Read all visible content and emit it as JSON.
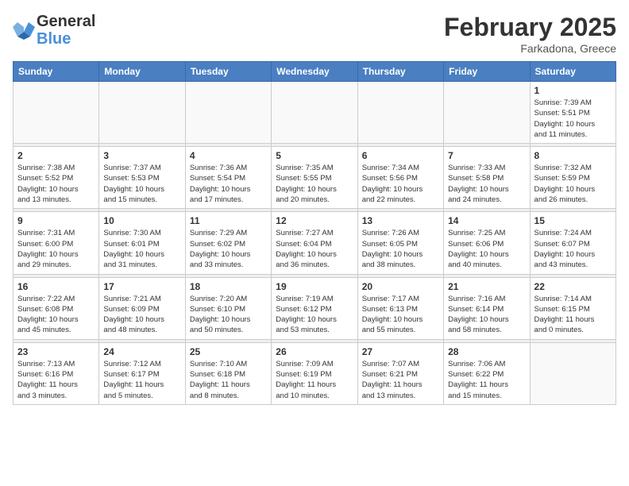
{
  "header": {
    "logo_general": "General",
    "logo_blue": "Blue",
    "month_title": "February 2025",
    "location": "Farkadona, Greece"
  },
  "weekdays": [
    "Sunday",
    "Monday",
    "Tuesday",
    "Wednesday",
    "Thursday",
    "Friday",
    "Saturday"
  ],
  "weeks": [
    [
      {
        "day": "",
        "info": ""
      },
      {
        "day": "",
        "info": ""
      },
      {
        "day": "",
        "info": ""
      },
      {
        "day": "",
        "info": ""
      },
      {
        "day": "",
        "info": ""
      },
      {
        "day": "",
        "info": ""
      },
      {
        "day": "1",
        "info": "Sunrise: 7:39 AM\nSunset: 5:51 PM\nDaylight: 10 hours\nand 11 minutes."
      }
    ],
    [
      {
        "day": "2",
        "info": "Sunrise: 7:38 AM\nSunset: 5:52 PM\nDaylight: 10 hours\nand 13 minutes."
      },
      {
        "day": "3",
        "info": "Sunrise: 7:37 AM\nSunset: 5:53 PM\nDaylight: 10 hours\nand 15 minutes."
      },
      {
        "day": "4",
        "info": "Sunrise: 7:36 AM\nSunset: 5:54 PM\nDaylight: 10 hours\nand 17 minutes."
      },
      {
        "day": "5",
        "info": "Sunrise: 7:35 AM\nSunset: 5:55 PM\nDaylight: 10 hours\nand 20 minutes."
      },
      {
        "day": "6",
        "info": "Sunrise: 7:34 AM\nSunset: 5:56 PM\nDaylight: 10 hours\nand 22 minutes."
      },
      {
        "day": "7",
        "info": "Sunrise: 7:33 AM\nSunset: 5:58 PM\nDaylight: 10 hours\nand 24 minutes."
      },
      {
        "day": "8",
        "info": "Sunrise: 7:32 AM\nSunset: 5:59 PM\nDaylight: 10 hours\nand 26 minutes."
      }
    ],
    [
      {
        "day": "9",
        "info": "Sunrise: 7:31 AM\nSunset: 6:00 PM\nDaylight: 10 hours\nand 29 minutes."
      },
      {
        "day": "10",
        "info": "Sunrise: 7:30 AM\nSunset: 6:01 PM\nDaylight: 10 hours\nand 31 minutes."
      },
      {
        "day": "11",
        "info": "Sunrise: 7:29 AM\nSunset: 6:02 PM\nDaylight: 10 hours\nand 33 minutes."
      },
      {
        "day": "12",
        "info": "Sunrise: 7:27 AM\nSunset: 6:04 PM\nDaylight: 10 hours\nand 36 minutes."
      },
      {
        "day": "13",
        "info": "Sunrise: 7:26 AM\nSunset: 6:05 PM\nDaylight: 10 hours\nand 38 minutes."
      },
      {
        "day": "14",
        "info": "Sunrise: 7:25 AM\nSunset: 6:06 PM\nDaylight: 10 hours\nand 40 minutes."
      },
      {
        "day": "15",
        "info": "Sunrise: 7:24 AM\nSunset: 6:07 PM\nDaylight: 10 hours\nand 43 minutes."
      }
    ],
    [
      {
        "day": "16",
        "info": "Sunrise: 7:22 AM\nSunset: 6:08 PM\nDaylight: 10 hours\nand 45 minutes."
      },
      {
        "day": "17",
        "info": "Sunrise: 7:21 AM\nSunset: 6:09 PM\nDaylight: 10 hours\nand 48 minutes."
      },
      {
        "day": "18",
        "info": "Sunrise: 7:20 AM\nSunset: 6:10 PM\nDaylight: 10 hours\nand 50 minutes."
      },
      {
        "day": "19",
        "info": "Sunrise: 7:19 AM\nSunset: 6:12 PM\nDaylight: 10 hours\nand 53 minutes."
      },
      {
        "day": "20",
        "info": "Sunrise: 7:17 AM\nSunset: 6:13 PM\nDaylight: 10 hours\nand 55 minutes."
      },
      {
        "day": "21",
        "info": "Sunrise: 7:16 AM\nSunset: 6:14 PM\nDaylight: 10 hours\nand 58 minutes."
      },
      {
        "day": "22",
        "info": "Sunrise: 7:14 AM\nSunset: 6:15 PM\nDaylight: 11 hours\nand 0 minutes."
      }
    ],
    [
      {
        "day": "23",
        "info": "Sunrise: 7:13 AM\nSunset: 6:16 PM\nDaylight: 11 hours\nand 3 minutes."
      },
      {
        "day": "24",
        "info": "Sunrise: 7:12 AM\nSunset: 6:17 PM\nDaylight: 11 hours\nand 5 minutes."
      },
      {
        "day": "25",
        "info": "Sunrise: 7:10 AM\nSunset: 6:18 PM\nDaylight: 11 hours\nand 8 minutes."
      },
      {
        "day": "26",
        "info": "Sunrise: 7:09 AM\nSunset: 6:19 PM\nDaylight: 11 hours\nand 10 minutes."
      },
      {
        "day": "27",
        "info": "Sunrise: 7:07 AM\nSunset: 6:21 PM\nDaylight: 11 hours\nand 13 minutes."
      },
      {
        "day": "28",
        "info": "Sunrise: 7:06 AM\nSunset: 6:22 PM\nDaylight: 11 hours\nand 15 minutes."
      },
      {
        "day": "",
        "info": ""
      }
    ]
  ]
}
